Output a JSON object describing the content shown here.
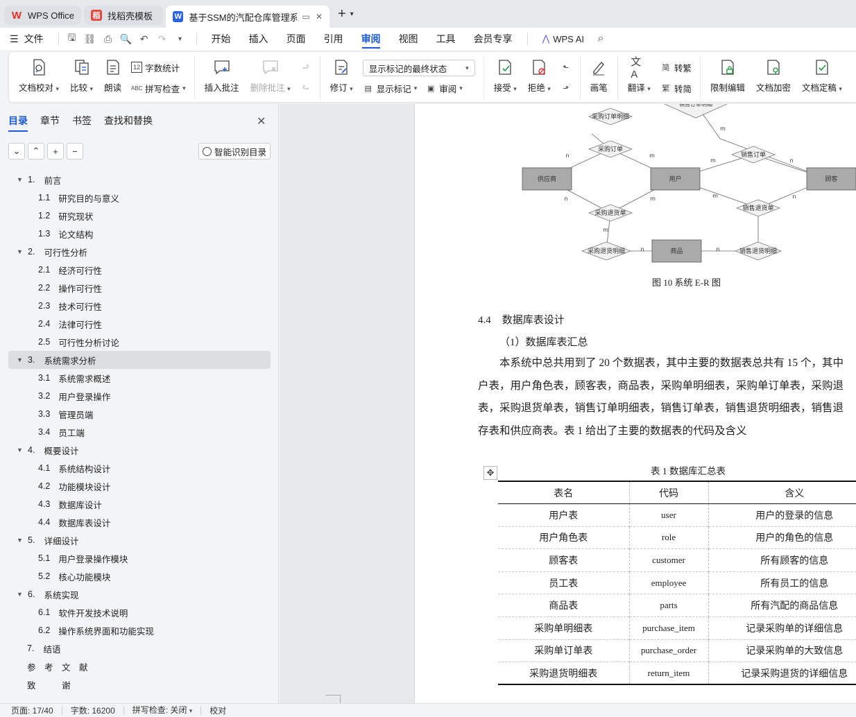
{
  "tabs": [
    {
      "label": "WPS Office",
      "logo": "W",
      "color": "#e0322b"
    },
    {
      "label": "找稻壳模板",
      "logo": "稻",
      "color": "#e8473d"
    },
    {
      "label": "基于SSM的汽配仓库管理系统",
      "logo": "W",
      "color": "#2b64e3"
    }
  ],
  "menu": {
    "file": "文件",
    "items": [
      "开始",
      "插入",
      "页面",
      "引用",
      "审阅",
      "视图",
      "工具",
      "会员专享"
    ],
    "active": "审阅",
    "ai": "WPS AI"
  },
  "ribbon": {
    "doc_check": "文档校对",
    "compare": "比较",
    "read_aloud": "朗读",
    "word_count": "字数统计",
    "spell_check": "拼写检查",
    "insert_comment": "插入批注",
    "delete_comment": "删除批注",
    "revise": "修订",
    "markup_state": "显示标记的最终状态",
    "show_markup": "显示标记",
    "review": "审阅",
    "accept": "接受",
    "reject": "拒绝",
    "pen": "画笔",
    "translate": "翻译",
    "to_traditional": "转繁",
    "to_simplified": "转简",
    "restrict_edit": "限制编辑",
    "encrypt": "文档加密",
    "finalize": "文档定稿"
  },
  "nav": {
    "tabs": [
      "目录",
      "章节",
      "书签",
      "查找和替换"
    ],
    "smart_toc": "智能识别目录",
    "toc": [
      {
        "level": 1,
        "num": "1.",
        "title": "前言"
      },
      {
        "level": 2,
        "num": "1.1",
        "title": "研究目的与意义"
      },
      {
        "level": 2,
        "num": "1.2",
        "title": "研究现状"
      },
      {
        "level": 2,
        "num": "1.3",
        "title": "论文结构"
      },
      {
        "level": 1,
        "num": "2.",
        "title": "可行性分析"
      },
      {
        "level": 2,
        "num": "2.1",
        "title": "经济可行性"
      },
      {
        "level": 2,
        "num": "2.2",
        "title": "操作可行性"
      },
      {
        "level": 2,
        "num": "2.3",
        "title": "技术可行性"
      },
      {
        "level": 2,
        "num": "2.4",
        "title": "法律可行性"
      },
      {
        "level": 2,
        "num": "2.5",
        "title": "可行性分析讨论"
      },
      {
        "level": 1,
        "num": "3.",
        "title": "系统需求分析",
        "selected": true
      },
      {
        "level": 2,
        "num": "3.1",
        "title": "系统需求概述"
      },
      {
        "level": 2,
        "num": "3.2",
        "title": "用户登录操作"
      },
      {
        "level": 2,
        "num": "3.3",
        "title": "管理员端"
      },
      {
        "level": 2,
        "num": "3.4",
        "title": "员工端"
      },
      {
        "level": 1,
        "num": "4.",
        "title": "概要设计"
      },
      {
        "level": 2,
        "num": "4.1",
        "title": "系统结构设计"
      },
      {
        "level": 2,
        "num": "4.2",
        "title": "功能模块设计"
      },
      {
        "level": 2,
        "num": "4.3",
        "title": "数据库设计"
      },
      {
        "level": 2,
        "num": "4.4",
        "title": "数据库表设计"
      },
      {
        "level": 1,
        "num": "5.",
        "title": "详细设计"
      },
      {
        "level": 2,
        "num": "5.1",
        "title": "用户登录操作模块"
      },
      {
        "level": 2,
        "num": "5.2",
        "title": "核心功能模块"
      },
      {
        "level": 1,
        "num": "6.",
        "title": "系统实现"
      },
      {
        "level": 2,
        "num": "6.1",
        "title": "软件开发技术说明"
      },
      {
        "level": 2,
        "num": "6.2",
        "title": "操作系统界面和功能实现"
      },
      {
        "level": 0,
        "num": "7.",
        "title": "结语"
      },
      {
        "level": 0,
        "num": "",
        "title": "参　考　文　献"
      },
      {
        "level": 0,
        "num": "",
        "title": "致　　　谢"
      }
    ]
  },
  "erd": {
    "entities": [
      "供应商",
      "用户",
      "顾客",
      "商品"
    ],
    "relations": [
      "采购订单明细",
      "采购订单",
      "销售订单",
      "采购退货单",
      "销售退货单",
      "采购退货明细",
      "销售退货明细",
      "销售订单明细"
    ],
    "cardinality": [
      "n",
      "m"
    ],
    "caption": "图 10  系统 E-R 图"
  },
  "doc": {
    "section_num": "4.4",
    "section_title": "数据库表设计",
    "subheading": "（1）数据库表汇总",
    "para_lines": [
      "本系统中总共用到了 20 个数据表，其中主要的数据表总共有 15 个，其中",
      "户表，用户角色表，顾客表，商品表，采购单明细表，采购单订单表，采购退",
      "表，采购退货单表，销售订单明细表，销售订单表，销售退货明细表，销售退",
      "存表和供应商表。表 1 给出了主要的数据表的代码及含义"
    ],
    "table_caption": "表 1  数据库汇总表",
    "table_headers": [
      "表名",
      "代码",
      "含义"
    ],
    "table_rows": [
      [
        "用户表",
        "user",
        "用户的登录的信息"
      ],
      [
        "用户角色表",
        "role",
        "用户的角色的信息"
      ],
      [
        "顾客表",
        "customer",
        "所有顾客的信息"
      ],
      [
        "员工表",
        "employee",
        "所有员工的信息"
      ],
      [
        "商品表",
        "parts",
        "所有汽配的商品信息"
      ],
      [
        "采购单明细表",
        "purchase_item",
        "记录采购单的详细信息"
      ],
      [
        "采购单订单表",
        "purchase_order",
        "记录采购单的大致信息"
      ],
      [
        "采购退货明细表",
        "return_item",
        "记录采购退货的详细信息"
      ]
    ]
  },
  "status": {
    "page": "页面: 17/40",
    "words": "字数: 16200",
    "spell": "拼写检查: 关闭",
    "proof": "校对"
  }
}
